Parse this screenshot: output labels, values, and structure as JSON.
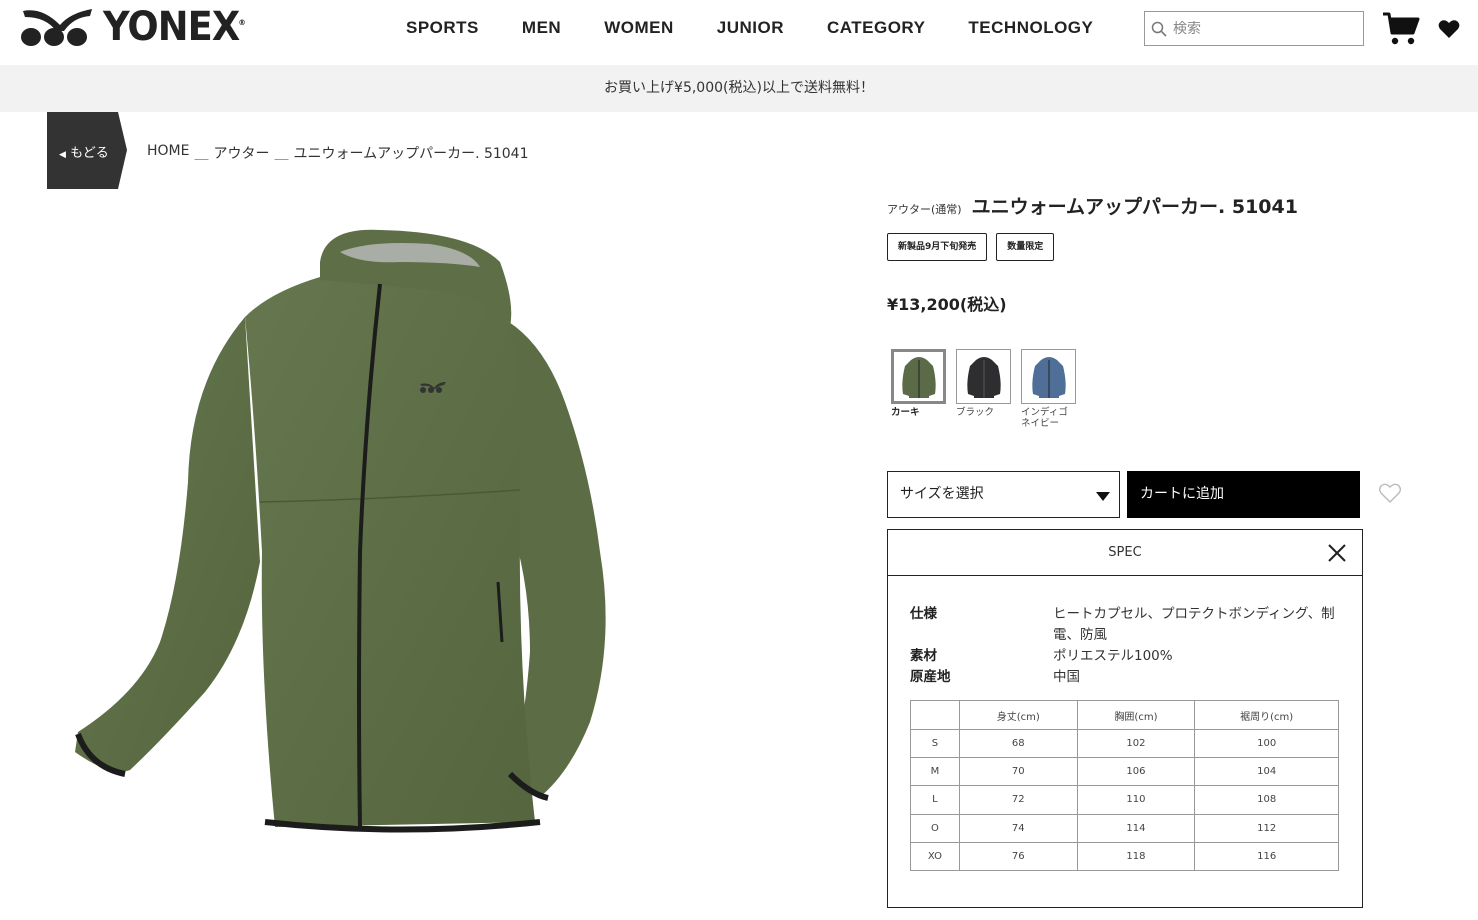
{
  "header": {
    "logo_text": "YONEX",
    "logo_registered": "®",
    "nav": [
      "SPORTS",
      "MEN",
      "WOMEN",
      "JUNIOR",
      "CATEGORY",
      "TECHNOLOGY"
    ],
    "search_placeholder": "検索",
    "icons": [
      "search-icon",
      "cart-icon",
      "heart-icon"
    ]
  },
  "banner": {
    "text": "お買い上げ¥5,000(税込)以上で送料無料！"
  },
  "back": {
    "label": "もどる",
    "icon": "triangle-left-icon"
  },
  "breadcrumb": {
    "items": [
      "HOME",
      "アウター",
      "ユニウォームアップパーカー. 51041"
    ],
    "separator": "＿"
  },
  "product": {
    "category": "アウター(通常)",
    "title": "ユニウォームアップパーカー. 51041",
    "tags": [
      "新製品9月下旬発売",
      "数量限定"
    ],
    "price": "¥13,200(税込)",
    "colors": [
      {
        "label": "カーキ",
        "hex": "#5b6b48",
        "selected": true
      },
      {
        "label": "ブラック",
        "hex": "#2e2e30",
        "selected": false
      },
      {
        "label": "インディゴネイビー",
        "hex": "#4f6e98",
        "selected": false
      }
    ],
    "size_select_label": "サイズを選択",
    "add_to_cart_label": "カートに追加"
  },
  "spec": {
    "title": "SPEC",
    "rows": [
      {
        "key": "仕様",
        "value": "ヒートカプセル、プロテクトボンディング、制電、防風"
      },
      {
        "key": "素材",
        "value": "ポリエステル100%"
      },
      {
        "key": "原産地",
        "value": "中国"
      }
    ],
    "size_table": {
      "headers": [
        "",
        "身丈(cm)",
        "胸囲(cm)",
        "裾周り(cm)"
      ],
      "rows": [
        [
          "S",
          "68",
          "102",
          "100"
        ],
        [
          "M",
          "70",
          "106",
          "104"
        ],
        [
          "L",
          "72",
          "110",
          "108"
        ],
        [
          "O",
          "74",
          "114",
          "112"
        ],
        [
          "XO",
          "76",
          "118",
          "116"
        ]
      ]
    }
  }
}
